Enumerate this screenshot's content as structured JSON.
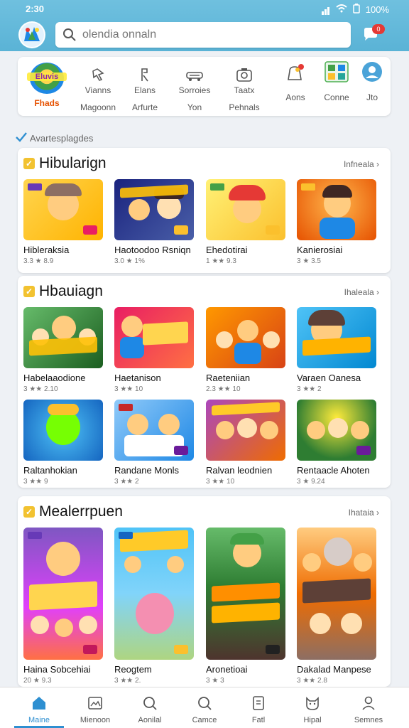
{
  "status": {
    "time": "2:30",
    "battery": "100%"
  },
  "search": {
    "placeholder": "olendia onnaln"
  },
  "notification_count": "0",
  "categories": [
    {
      "icon": "app-logo-icon",
      "line1": "Eluvis",
      "line2": "Fhads"
    },
    {
      "icon": "pointer-icon",
      "line1": "Vianns",
      "line2": "Magoonn"
    },
    {
      "icon": "runner-icon",
      "line1": "Elans",
      "line2": "Arfurte"
    },
    {
      "icon": "car-icon",
      "line1": "Sorroies",
      "line2": "Yon"
    },
    {
      "icon": "camera-icon",
      "line1": "Taatx",
      "line2": "Pehnals"
    },
    {
      "icon": "bag-icon",
      "line1": "",
      "line2": "Aons"
    },
    {
      "icon": "grid-apps-icon",
      "line1": "",
      "line2": "Conne"
    },
    {
      "icon": "profile-icon",
      "line1": "",
      "line2": "Jto"
    }
  ],
  "section_label": "Avartesplagdes",
  "sections": [
    {
      "title": "Hibularign",
      "more": "Infneala",
      "tiles": [
        {
          "name": "Hibleraksia",
          "meta": "3.3 ★ 8.9",
          "theme": "yellow"
        },
        {
          "name": "Haotoodoo Rsniqn",
          "meta": "3.0 ★ 1%",
          "theme": "navy"
        },
        {
          "name": "Ehedotirai",
          "meta": "1 ★★ 9.3",
          "theme": "gold"
        },
        {
          "name": "Kanierosiai",
          "meta": "3 ★ 3.5",
          "theme": "orange"
        }
      ]
    },
    {
      "title": "Hbauiagn",
      "more": "Ihaleala",
      "tiles": [
        {
          "name": "Habelaaodione",
          "meta": "3 ★★ 2.10",
          "theme": "green"
        },
        {
          "name": "Haetanison",
          "meta": "3 ★★ 10",
          "theme": "magenta"
        },
        {
          "name": "Raeteniian",
          "meta": "2.3 ★★ 10",
          "theme": "orange"
        },
        {
          "name": "Varaen Oanesa",
          "meta": "3 ★★ 2",
          "theme": "yellow"
        },
        {
          "name": "Raltanhokian",
          "meta": "3 ★★ 9",
          "theme": "blue"
        },
        {
          "name": "Randane Monls",
          "meta": "3 ★★ 2",
          "theme": "sky"
        },
        {
          "name": "Ralvan leodnien",
          "meta": "3 ★★ 10",
          "theme": "purple"
        },
        {
          "name": "Rentaacle Ahoten",
          "meta": "3 ★ 9.24",
          "theme": "green"
        }
      ]
    },
    {
      "title": "Mealerrpuen",
      "more": "Ihataia",
      "tiles": [
        {
          "name": "Haina Sobcehiai",
          "meta": "20 ★ 9.3",
          "theme": "purple"
        },
        {
          "name": "Reogtem",
          "meta": "3 ★★ 2.",
          "theme": "sky"
        },
        {
          "name": "Aronetioai",
          "meta": "3 ★ 3",
          "theme": "green"
        },
        {
          "name": "Dakalad Manpese",
          "meta": "3 ★★ 2.8",
          "theme": "orange"
        }
      ]
    }
  ],
  "nav": [
    {
      "icon": "home-icon",
      "label": "Maine"
    },
    {
      "icon": "gallery-icon",
      "label": "Mienoon"
    },
    {
      "icon": "search-icon",
      "label": "Aonilal"
    },
    {
      "icon": "games-icon",
      "label": "Camce"
    },
    {
      "icon": "file-icon",
      "label": "Fatl"
    },
    {
      "icon": "pet-icon",
      "label": "Hipal"
    },
    {
      "icon": "person-icon",
      "label": "Semnes"
    }
  ],
  "colors": {
    "header": "#5ab3d6",
    "accent": "#2e8fd1",
    "check": "#f2c230",
    "star": "#f5a623"
  }
}
